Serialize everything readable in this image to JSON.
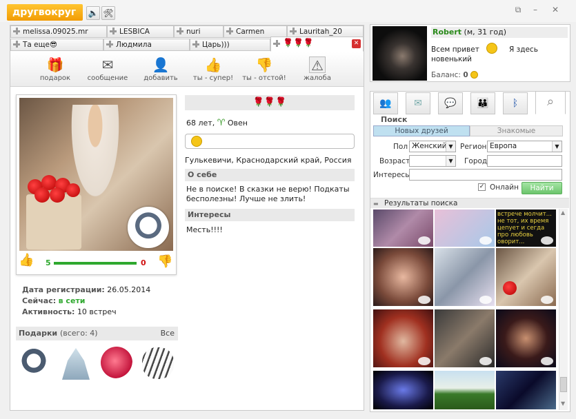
{
  "app": {
    "logo": "другвокруг",
    "sound_icon": "speaker-icon",
    "settings_icon": "tools-icon"
  },
  "tabs": {
    "row1": [
      "melissa.09025.mr",
      "LESBICA",
      "nuri",
      "Carmen",
      "Lauritah_20"
    ],
    "row2": [
      "Та еще😎",
      "Людмила",
      "Царь)))"
    ],
    "active": "🌹🌹🌹"
  },
  "toolbar": {
    "gift": "подарок",
    "message": "сообщение",
    "add": "добавить",
    "like": "ты - супер!",
    "dislike": "ты - отстой!",
    "complain": "жалоба"
  },
  "profile": {
    "likes": "5",
    "dislikes": "0",
    "likes_fraction": 1.0,
    "header_roses": "🌹🌹🌹",
    "age_sign": "68 лет,",
    "zodiac_symbol": "♈",
    "zodiac": "Овен",
    "location": "Гулькевичи, Краснодарский край, Россия",
    "about_title": "О себе",
    "about_text": "Не в поиске! В сказки не верю! Подкаты бесполезны! Лучше не злить!",
    "interests_title": "Интересы",
    "interests_text": "Месть!!!!",
    "reg_label": "Дата регистрации:",
    "reg_value": "26.05.2014",
    "now_label": "Сейчас:",
    "now_value": "в сети",
    "activity_label": "Активность:",
    "activity_value": "10 встреч",
    "gifts_label": "Подарки",
    "gifts_count": "(всего: 4)",
    "gifts_all": "Все"
  },
  "me": {
    "name": "Robert",
    "info": "(м, 31 год)",
    "status_a": "Всем привет",
    "status_b": "Я здесь",
    "status_c": "новенький",
    "balance_label": "Баланс:",
    "balance_value": "0"
  },
  "search": {
    "title": "Поиск",
    "tab_new": "Новых друзей",
    "tab_known": "Знакомые",
    "sex_label": "Пол",
    "sex_value": "Женский",
    "region_label": "Регион",
    "region_value": "Европа",
    "age_label": "Возраст",
    "age_value": "",
    "city_label": "Город",
    "city_value": "",
    "interests_label": "Интересы",
    "interests_value": "",
    "online_label": "Онлайн",
    "online_checked": true,
    "find_button": "Найти",
    "results_label": "Результаты поиска",
    "thumb_text": "встрече молчит... не тот, их время цепует и сегда про любовь оворит..."
  },
  "colors": {
    "accent": "#f7a910",
    "online": "#2ea82e",
    "dislike": "#d01010",
    "find": "#7dd27d",
    "name": "#2a8a1a"
  }
}
